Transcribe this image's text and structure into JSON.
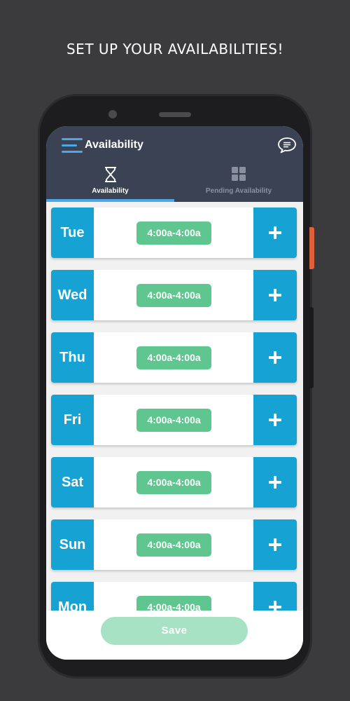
{
  "caption": "SET UP YOUR AVAILABILITIES!",
  "header": {
    "title": "Availability",
    "menu_icon": "hamburger-menu-icon",
    "chat_icon": "chat-bubble-icon"
  },
  "tabs": [
    {
      "label": "Availability",
      "icon": "hourglass-icon",
      "active": true
    },
    {
      "label": "Pending Availability",
      "icon": "grid-icon",
      "active": false
    }
  ],
  "days": [
    {
      "day": "Tue",
      "time": "4:00a-4:00a"
    },
    {
      "day": "Wed",
      "time": "4:00a-4:00a"
    },
    {
      "day": "Thu",
      "time": "4:00a-4:00a"
    },
    {
      "day": "Fri",
      "time": "4:00a-4:00a"
    },
    {
      "day": "Sat",
      "time": "4:00a-4:00a"
    },
    {
      "day": "Sun",
      "time": "4:00a-4:00a"
    },
    {
      "day": "Mon",
      "time": "4:00a-4:00a"
    }
  ],
  "footer": {
    "save_label": "Save"
  },
  "colors": {
    "background": "#3b3a3c",
    "header": "#3a4254",
    "accent_blue": "#16a3d3",
    "tab_indicator": "#4aa8e8",
    "time_pill_green": "#5ec68e",
    "save_button_disabled": "#a8e2c4"
  }
}
